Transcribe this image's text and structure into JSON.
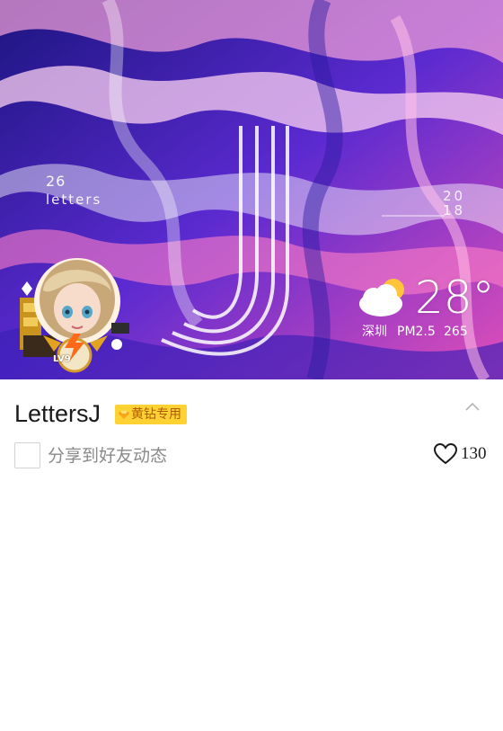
{
  "banner": {
    "brand_number": "26",
    "brand_word": "letters",
    "year_top": "20",
    "year_bottom": "18",
    "colors": {
      "deep_blue": "#2a1a9a",
      "violet": "#6a2bd6",
      "magenta": "#d84ac0",
      "pink": "#f45aa8"
    }
  },
  "weather": {
    "icon": "partly-cloudy-icon",
    "temperature": "28°",
    "city": "深圳",
    "pm_label": "PM2.5",
    "pm_value": "265"
  },
  "avatar": {
    "icon": "avatar-character",
    "level": "LV9"
  },
  "profile": {
    "name": "LettersJ",
    "vip_badge": "黄钻专用",
    "vip_color": "#ffd233"
  },
  "actions": {
    "share_label": "分享到好友动态",
    "like_icon": "heart-icon",
    "like_count": "130",
    "collapse_icon": "chevron-up-icon"
  }
}
